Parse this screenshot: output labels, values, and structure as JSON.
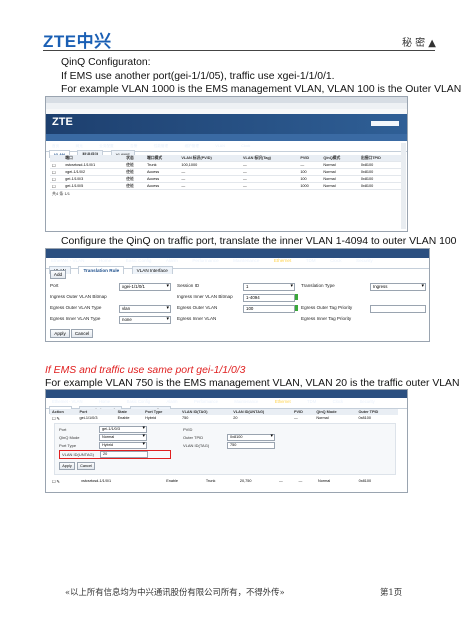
{
  "header": {
    "logo": "ZTE中兴",
    "secret_label": "秘 密 ▲"
  },
  "text": {
    "line1": "QinQ Configuraton:",
    "line2": "If EMS use another port(gei-1/1/05), traffic use xgei-1/1/0/1.",
    "line3": "For example VLAN 1000 is the EMS management VLAN, VLAN 100 is the Outer VLAN",
    "line4": "Configure the QinQ on traffic port, translate the inner VLAN 1-4094 to outer VLAN 100",
    "line5": "If EMS and traffic use same port gei-1/1/0/3",
    "line6": "For example VLAN 750 is the EMS management VLAN, VLAN 20 is the traffic outer VLAN"
  },
  "shot1": {
    "logo": "ZTE",
    "nav": [
      "首页",
      "网元",
      "业务配置",
      "告警",
      "性能管理",
      "维护管理",
      "VLAN",
      "Clock"
    ],
    "tabs": [
      "VLAN",
      "翻译规则",
      "VLANIF"
    ],
    "columns": [
      "",
      "端口",
      "状态",
      "端口模式",
      "VLAN 标识(PVID)",
      "VLAN 标识(Tag)",
      "PVID",
      "QinQ模式",
      "出接口TPID"
    ],
    "rows": [
      [
        "",
        "xstcsrtosd-1/1/0/1",
        "使能",
        "Trunk",
        "100,1000",
        "—",
        "—",
        "Normal",
        "0x8100"
      ],
      [
        "",
        "xgei-1/1/0/2",
        "使能",
        "Access",
        "—",
        "—",
        "100",
        "Normal",
        "0x8100"
      ],
      [
        "",
        "gei-1/1/0/3",
        "使能",
        "Access",
        "—",
        "—",
        "100",
        "Normal",
        "0x8100"
      ],
      [
        "",
        "gei-1/1/0/5",
        "使能",
        "Access",
        "—",
        "—",
        "1000",
        "Normal",
        "0x8100"
      ]
    ],
    "pager": "共4 条 1/1"
  },
  "shot2": {
    "nav": [
      "Ethernet - VLAN",
      "Home",
      "Basic Config",
      "Alarm",
      "Performance",
      "Maintenance",
      "Ethernet",
      "TDM",
      "Clock",
      "Security"
    ],
    "tabs": [
      "VLAN",
      "Translation Rule",
      "VLAN Interface"
    ],
    "add": "Add",
    "fields": {
      "port_label": "Port",
      "port_value": "xgei-1/1/0/1",
      "session_label": "Session ID",
      "session_value": "1",
      "ttype_label": "Translation Type",
      "ttype_value": "Ingress",
      "eov_bitmap_label": "Ingress Outer VLAN Bitmap",
      "eiv_bitmap_label": "Ingress Inner VLAN Bitmap",
      "eiv_bitmap_value": "1-4094",
      "outer_type_label": "Egress Outer VLAN Type",
      "outer_type_value": "vlan",
      "egress_outer_vlan_label": "Egress Outer VLAN",
      "egress_outer_vlan_value": "100",
      "outer_pri_label": "Egress Outer Tag Priority",
      "inner_type_label": "Egress Inner VLAN Type",
      "inner_type_value": "none",
      "egress_inner_vlan_label": "Egress Inner VLAN",
      "inner_pri_label": "Egress Inner Tag Priority"
    },
    "apply": "Apply",
    "cancel": "Cancel"
  },
  "shot3": {
    "nav": [
      "Ethernet - VLAN",
      "Home",
      "Basic Config",
      "Alarm",
      "Performance",
      "Maintenance",
      "Ethernet",
      "TDM",
      "Clock",
      "Security"
    ],
    "tabs": [
      "VLAN",
      "Translation Rule",
      "VLAN Interface"
    ],
    "columns": [
      "Action",
      "Port",
      "State",
      "Port Type",
      "VLAN ID(TAG)",
      "VLAN ID(UNTAG)",
      "PVID",
      "QinQ Mode",
      "Outer TPID"
    ],
    "row1": [
      "",
      "gei-1/1/0/3",
      "Enable",
      "Hybrid",
      "750",
      "20",
      "—",
      "Normal",
      "0x8100"
    ],
    "detail": {
      "port_label": "Port",
      "port_value": "gei-1/1/0/3",
      "qinq_label": "QinQ Mode",
      "qinq_value": "Normal",
      "ptype_label": "Port Type",
      "ptype_value": "Hybrid",
      "pvid_label": "PVID",
      "tpid_label": "Outer TPID",
      "tpid_value": "0x8100",
      "tag_label": "VLAN ID(TAG)",
      "tag_value": "750",
      "untag_label": "VLAN ID(UNTAG)",
      "untag_value": "20"
    },
    "apply": "Apply",
    "cancel": "Cancel",
    "row2": [
      "",
      "xstcsrtosd-1/1/0/1",
      "Enable",
      "Trunk",
      "20,750",
      "—",
      "—",
      "Normal",
      "0x8100"
    ]
  },
  "footer": {
    "note": "«以上所有信息均为中兴通讯股份有限公司所有，不得外传»",
    "page": "第1页"
  }
}
